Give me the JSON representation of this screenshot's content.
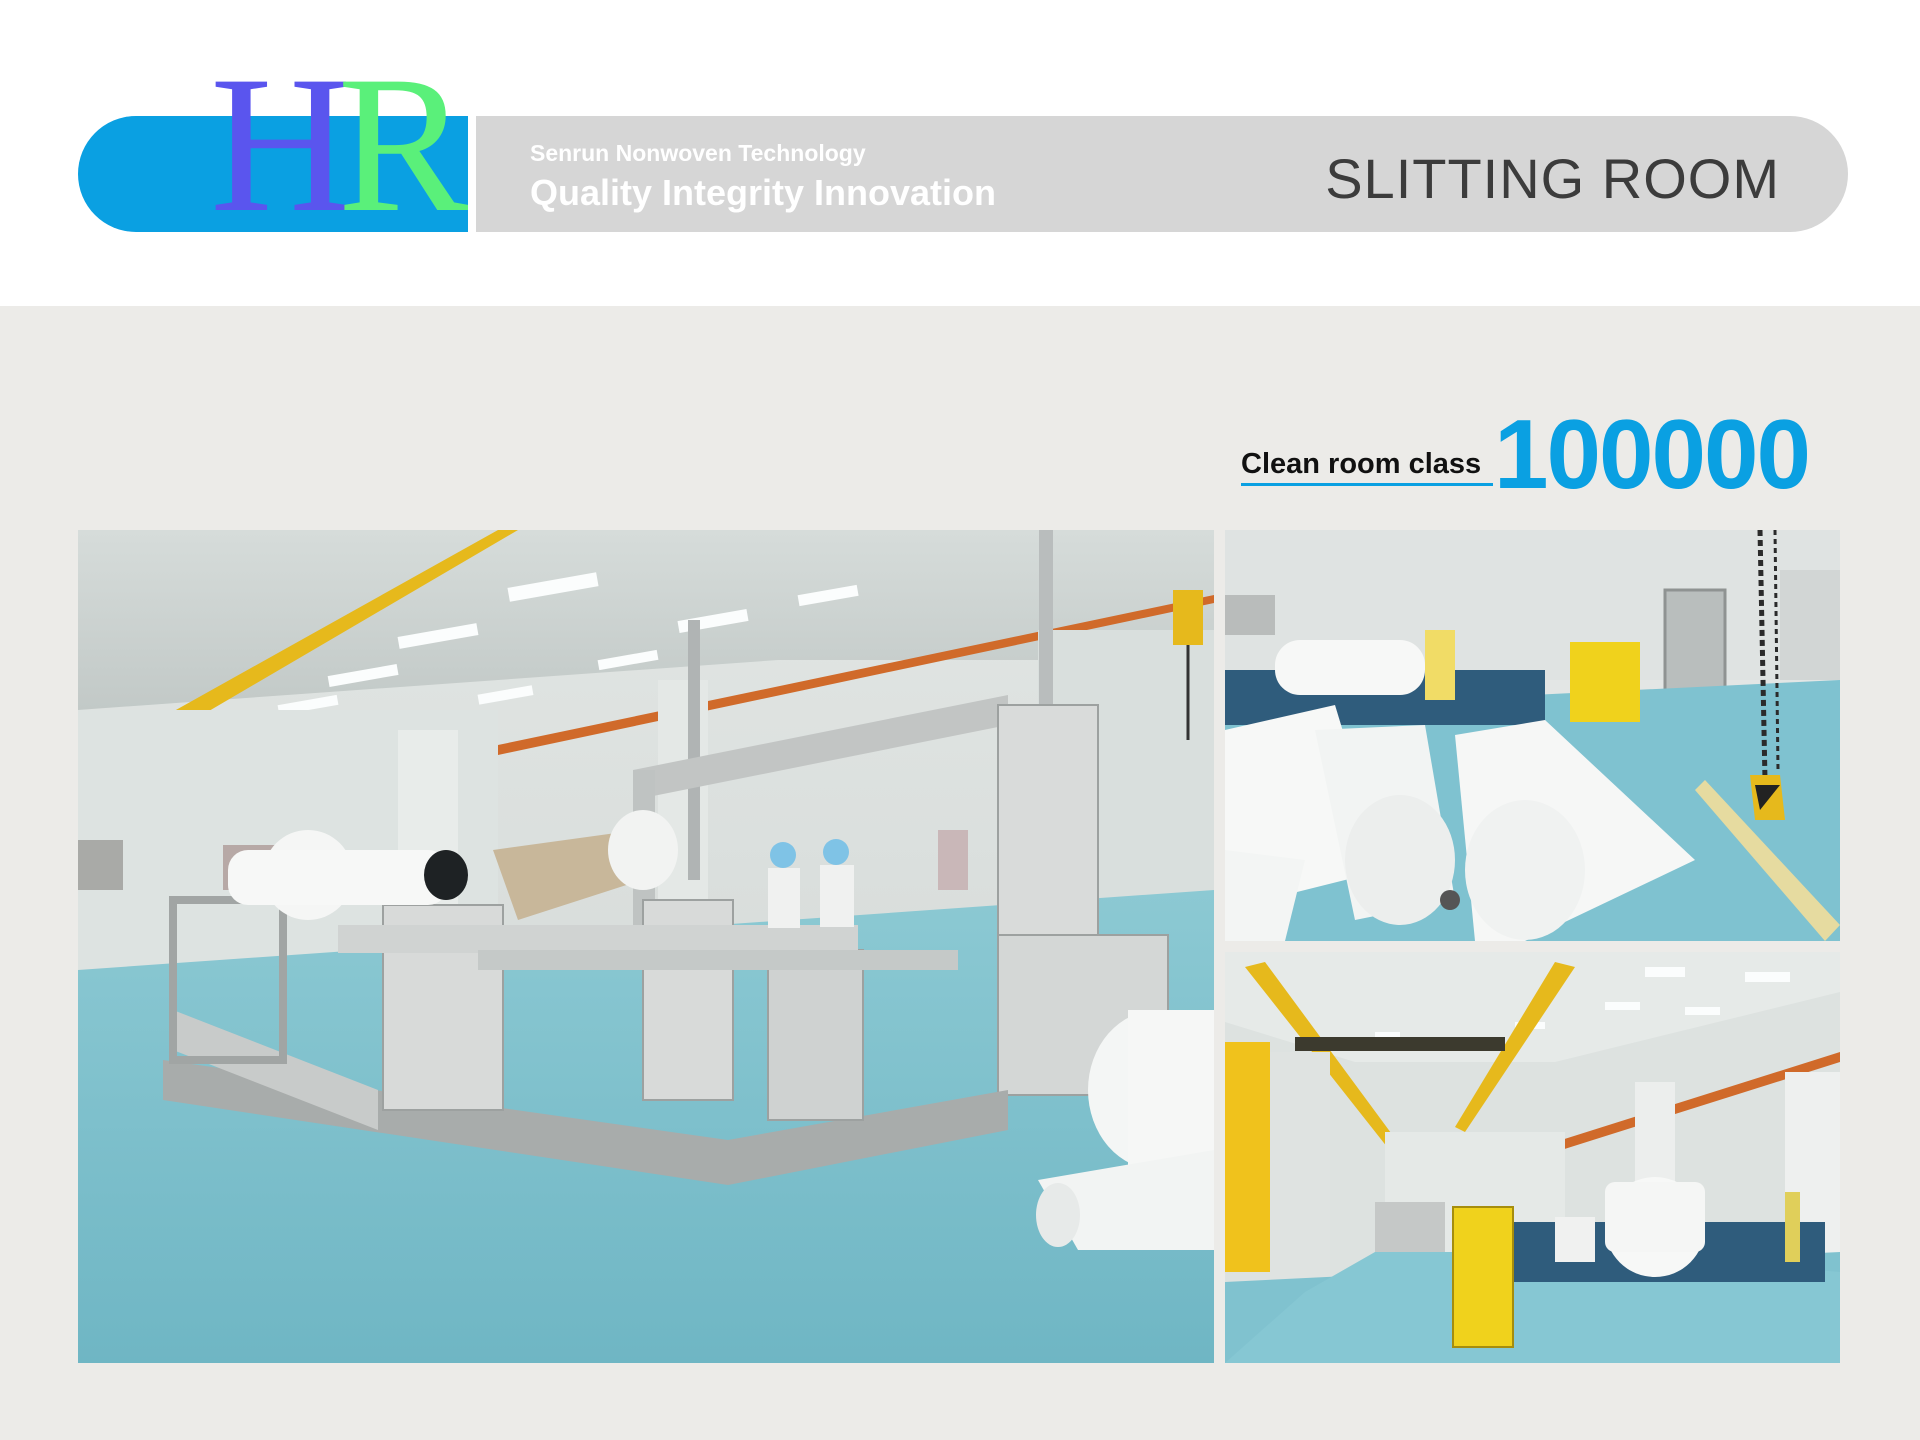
{
  "logo": {
    "h": "H",
    "r": "R"
  },
  "header": {
    "company": "Senrun Nonwoven Technology",
    "tagline": "Quality  Integrity Innovation",
    "title": "SLITTING ROOM"
  },
  "clean_room": {
    "label": "Clean room class",
    "value": "100000"
  },
  "colors": {
    "brand_blue": "#0aa0e2",
    "bar_gray": "#d6d6d6",
    "floor_teal": "#7cc0cc",
    "crane_yellow": "#e6b91c"
  },
  "photos": [
    {
      "subject": "slitting-machine-main"
    },
    {
      "subject": "nonwoven-rolls-closeup"
    },
    {
      "subject": "clean-room-overview"
    }
  ]
}
